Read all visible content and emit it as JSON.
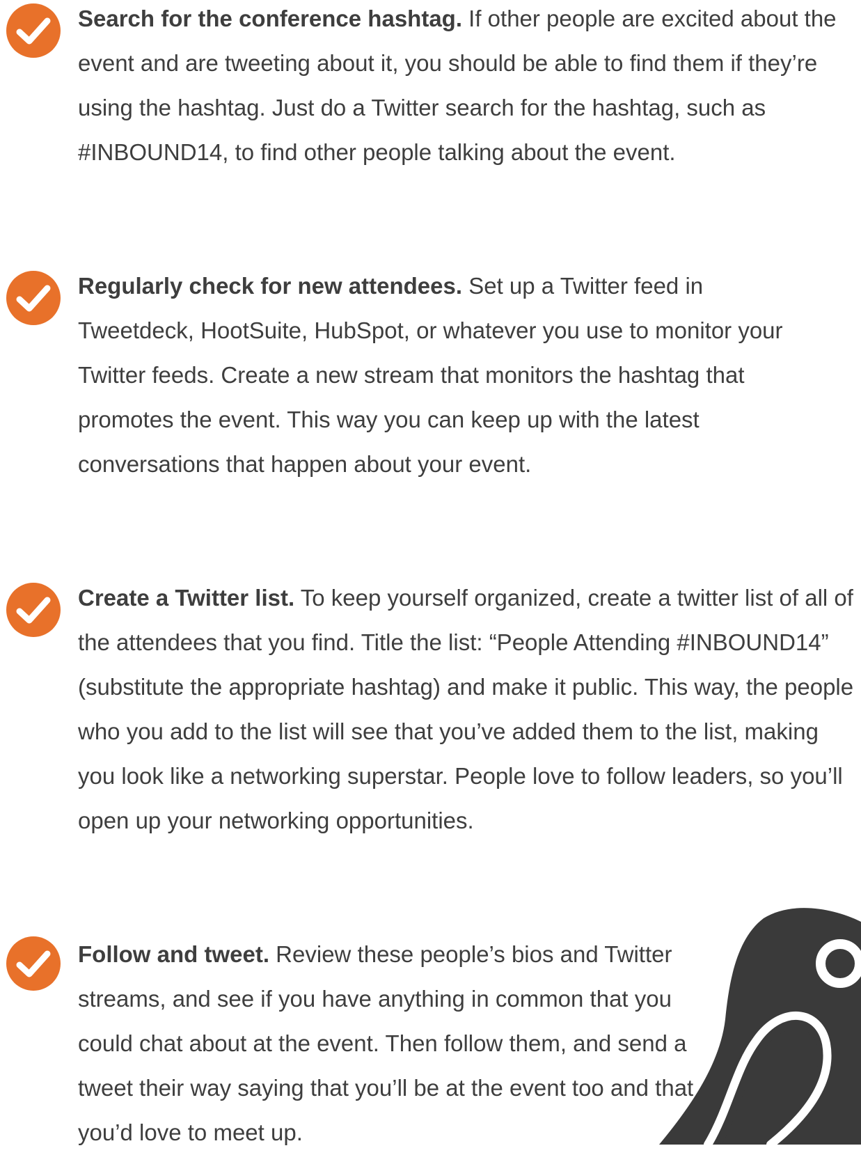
{
  "items": [
    {
      "title": "Search for the conference hashtag.",
      "body": " If other people are excited about the event and are tweeting about it, you should be able to find them if they’re using the hashtag. Just do a Twitter search for the hashtag, such as #INBOUND14, to find other people talking about the event."
    },
    {
      "title": "Regularly check for new attendees.",
      "body": " Set up a Twitter feed in Tweetdeck, HootSuite, HubSpot, or whatever you use to monitor your Twitter feeds. Create a new stream that monitors the hashtag that promotes the event. This way you can keep up with the latest conversations that happen about your event."
    },
    {
      "title": "Create a Twitter list.",
      "body": " To keep yourself organized, create a twitter list of all of the attendees that you find. Title the list: “People Attending #INBOUND14” (substitute the appropriate hashtag) and make it public. This way, the people who you add to the list will see that you’ve added them to the list, making you look like a networking superstar. People love to follow leaders, so you’ll open up your networking opportunities."
    },
    {
      "title": "Follow and tweet.",
      "body": " Review these people’s bios and Twitter streams, and see if you have anything in common that you could chat about at the event. Then follow them, and send a tweet their way saying that you’ll be at the event too and that you’d love to meet up."
    }
  ],
  "colors": {
    "check": "#E8712A",
    "text": "#3E3E3E",
    "mascot": "#3A3A3A"
  },
  "icons": {
    "check": "checkmark-circle-icon",
    "mascot": "bird-mascot-illustration"
  }
}
